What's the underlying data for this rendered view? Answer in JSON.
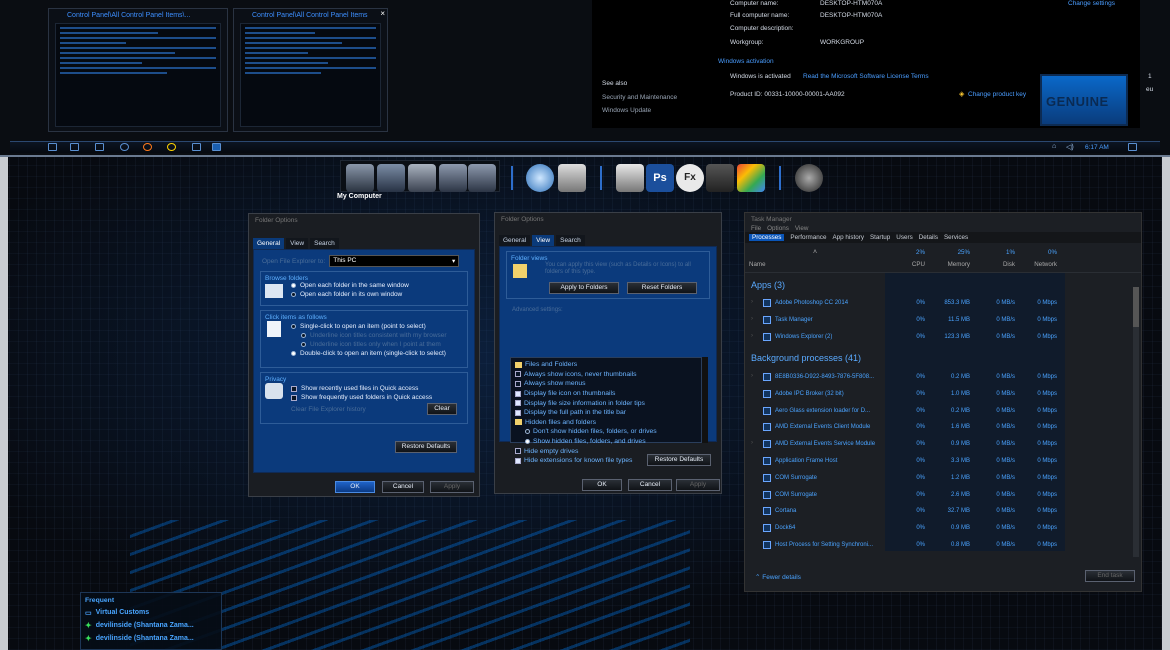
{
  "taskview": {
    "thumb1_title": "Control Panel\\All Control Panel Items\\...",
    "thumb2_title": "Control Panel\\All Control Panel Items",
    "see_also": "See also",
    "see_also_items": [
      "Security and Maintenance",
      "Windows Update"
    ]
  },
  "system": {
    "rows": [
      {
        "label": "Computer name:",
        "value": "DESKTOP-HTM070A"
      },
      {
        "label": "Full computer name:",
        "value": "DESKTOP-HTM070A"
      },
      {
        "label": "Computer description:",
        "value": ""
      },
      {
        "label": "Workgroup:",
        "value": "WORKGROUP"
      }
    ],
    "change_settings": "Change settings",
    "activation_heading": "Windows activation",
    "activated": "Windows is activated",
    "license_link": "Read the Microsoft Software License Terms",
    "product_id": "Product ID: 00331-10000-00001-AA092",
    "change_key": "Change product key",
    "genuine": "GENUINE",
    "edge_text": [
      "1",
      "eu"
    ]
  },
  "taskbar": {
    "clock": "6:17 AM"
  },
  "dock": {
    "label": "My Computer"
  },
  "folder1": {
    "title": "Folder Options",
    "tabs": [
      "General",
      "View",
      "Search"
    ],
    "open_label": "Open File Explorer to:",
    "open_value": "This PC",
    "browse_heading": "Browse folders",
    "browse_opts": [
      "Open each folder in the same window",
      "Open each folder in its own window"
    ],
    "click_heading": "Click items as follows",
    "click_opts": [
      "Single-click to open an item (point to select)",
      "Underline icon titles consistent with my browser",
      "Underline icon titles only when I point at them",
      "Double-click to open an item (single-click to select)"
    ],
    "privacy_heading": "Privacy",
    "privacy_opts": [
      "Show recently used files in Quick access",
      "Show frequently used folders in Quick access"
    ],
    "clear_history": "Clear File Explorer history",
    "clear": "Clear",
    "restore": "Restore Defaults",
    "ok": "OK",
    "cancel": "Cancel",
    "apply": "Apply"
  },
  "folder2": {
    "title": "Folder Options",
    "tabs": [
      "General",
      "View",
      "Search"
    ],
    "views_heading": "Folder views",
    "views_text": "You can apply this view (such as Details or Icons) to all folders of this type.",
    "apply_folders": "Apply to Folders",
    "reset_folders": "Reset Folders",
    "adv_heading": "Advanced settings:",
    "adv_items": [
      {
        "text": "Files and Folders",
        "kind": "folder"
      },
      {
        "text": "Always show icons, never thumbnails",
        "kind": "chk",
        "on": false
      },
      {
        "text": "Always show menus",
        "kind": "chk",
        "on": false
      },
      {
        "text": "Display file icon on thumbnails",
        "kind": "chk",
        "on": true
      },
      {
        "text": "Display file size information in folder tips",
        "kind": "chk",
        "on": true
      },
      {
        "text": "Display the full path in the title bar",
        "kind": "chk",
        "on": true
      },
      {
        "text": "Hidden files and folders",
        "kind": "folder"
      },
      {
        "text": "Don't show hidden files, folders, or drives",
        "kind": "radio",
        "on": false
      },
      {
        "text": "Show hidden files, folders, and drives",
        "kind": "radio",
        "on": true
      },
      {
        "text": "Hide empty drives",
        "kind": "chk",
        "on": false
      },
      {
        "text": "Hide extensions for known file types",
        "kind": "chk",
        "on": true
      }
    ],
    "restore": "Restore Defaults",
    "ok": "OK",
    "cancel": "Cancel",
    "apply": "Apply"
  },
  "taskmgr": {
    "title": "Task Manager",
    "menu": [
      "File",
      "Options",
      "View"
    ],
    "tabs": [
      "Processes",
      "Performance",
      "App history",
      "Startup",
      "Users",
      "Details",
      "Services"
    ],
    "col_name": "Name",
    "cols": [
      {
        "pct": "2%",
        "name": "CPU"
      },
      {
        "pct": "25%",
        "name": "Memory"
      },
      {
        "pct": "1%",
        "name": "Disk"
      },
      {
        "pct": "0%",
        "name": "Network"
      }
    ],
    "apps_heading": "Apps (3)",
    "apps": [
      {
        "name": "Adobe Photoshop CC 2014",
        "cpu": "0%",
        "mem": "853.3 MB",
        "disk": "0 MB/s",
        "net": "0 Mbps"
      },
      {
        "name": "Task Manager",
        "cpu": "0%",
        "mem": "11.5 MB",
        "disk": "0 MB/s",
        "net": "0 Mbps"
      },
      {
        "name": "Windows Explorer (2)",
        "cpu": "0%",
        "mem": "123.3 MB",
        "disk": "0 MB/s",
        "net": "0 Mbps"
      }
    ],
    "bg_heading": "Background processes (41)",
    "bg": [
      {
        "name": "8E8B0336-D922-8493-7876-5F808...",
        "cpu": "0%",
        "mem": "0.2 MB",
        "disk": "0 MB/s",
        "net": "0 Mbps"
      },
      {
        "name": "Adobe IPC Broker (32 bit)",
        "cpu": "0%",
        "mem": "1.0 MB",
        "disk": "0 MB/s",
        "net": "0 Mbps"
      },
      {
        "name": "Aero Glass extension loader for D...",
        "cpu": "0%",
        "mem": "0.2 MB",
        "disk": "0 MB/s",
        "net": "0 Mbps"
      },
      {
        "name": "AMD External Events Client Module",
        "cpu": "0%",
        "mem": "1.6 MB",
        "disk": "0 MB/s",
        "net": "0 Mbps"
      },
      {
        "name": "AMD External Events Service Module",
        "cpu": "0%",
        "mem": "0.9 MB",
        "disk": "0 MB/s",
        "net": "0 Mbps"
      },
      {
        "name": "Application Frame Host",
        "cpu": "0%",
        "mem": "3.3 MB",
        "disk": "0 MB/s",
        "net": "0 Mbps"
      },
      {
        "name": "COM Surrogate",
        "cpu": "0%",
        "mem": "1.2 MB",
        "disk": "0 MB/s",
        "net": "0 Mbps"
      },
      {
        "name": "COM Surrogate",
        "cpu": "0%",
        "mem": "2.6 MB",
        "disk": "0 MB/s",
        "net": "0 Mbps"
      },
      {
        "name": "Cortana",
        "cpu": "0%",
        "mem": "32.7 MB",
        "disk": "0 MB/s",
        "net": "0 Mbps"
      },
      {
        "name": "Dock64",
        "cpu": "0%",
        "mem": "0.9 MB",
        "disk": "0 MB/s",
        "net": "0 Mbps"
      },
      {
        "name": "Host Process for Setting Synchroni...",
        "cpu": "0%",
        "mem": "0.8 MB",
        "disk": "0 MB/s",
        "net": "0 Mbps"
      }
    ],
    "fewer": "Fewer details",
    "end_task": "End task"
  },
  "frequent": {
    "heading": "Frequent",
    "items": [
      "Virtual Customs",
      "devilinside (Shantana Zama...",
      "devilinside (Shantana Zama..."
    ]
  }
}
